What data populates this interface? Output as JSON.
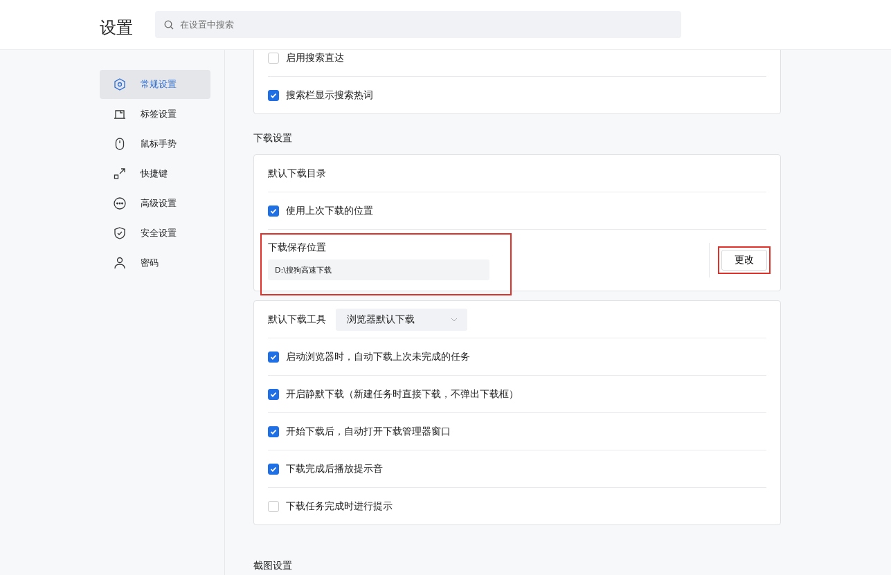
{
  "header": {
    "title": "设置",
    "search": {
      "placeholder": "在设置中搜索"
    }
  },
  "sidebar": {
    "items": [
      {
        "label": "常规设置",
        "selected": true
      },
      {
        "label": "标签设置",
        "selected": false
      },
      {
        "label": "鼠标手势",
        "selected": false
      },
      {
        "label": "快捷键",
        "selected": false
      },
      {
        "label": "高级设置",
        "selected": false
      },
      {
        "label": "安全设置",
        "selected": false
      },
      {
        "label": "密码",
        "selected": false
      }
    ]
  },
  "search_card": {
    "options": [
      {
        "label": "启用搜索直达",
        "checked": false
      },
      {
        "label": "搜索栏显示搜索热词",
        "checked": true
      }
    ]
  },
  "download_section": {
    "title": "下载设置",
    "directory_card": {
      "title": "默认下载目录",
      "use_last": {
        "label": "使用上次下载的位置",
        "checked": true
      },
      "save_location": {
        "label": "下载保存位置",
        "path": "D:\\搜狗高速下载",
        "highlighted": true
      },
      "change_button": {
        "label": "更改",
        "highlighted": true
      }
    },
    "tool_card": {
      "tool_label": "默认下载工具",
      "tool_value": "浏览器默认下载",
      "options": [
        {
          "label": "启动浏览器时，自动下载上次未完成的任务",
          "checked": true
        },
        {
          "label": "开启静默下载（新建任务时直接下载，不弹出下载框）",
          "checked": true
        },
        {
          "label": "开始下载后，自动打开下载管理器窗口",
          "checked": true
        },
        {
          "label": "下载完成后播放提示音",
          "checked": true
        },
        {
          "label": "下载任务完成时进行提示",
          "checked": false
        }
      ]
    }
  },
  "screenshot_section": {
    "title": "截图设置"
  }
}
